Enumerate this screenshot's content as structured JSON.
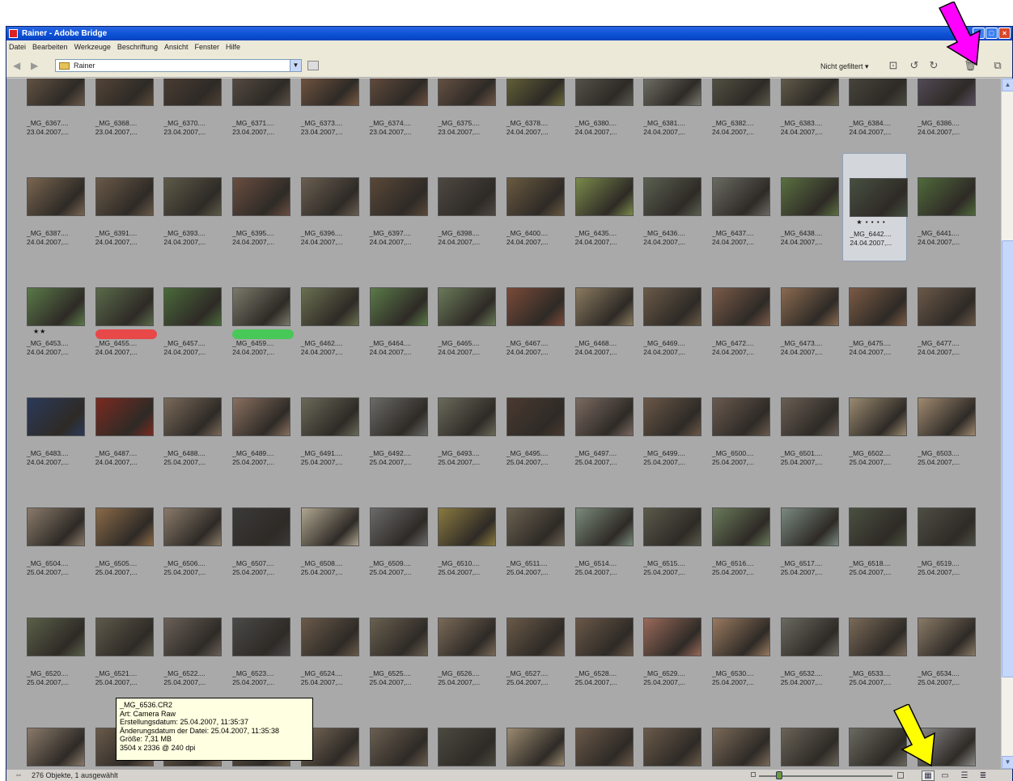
{
  "window": {
    "title": "Rainer - Adobe Bridge",
    "controls": [
      "_",
      "□",
      "×"
    ]
  },
  "menu": [
    "Datei",
    "Bearbeiten",
    "Werkzeuge",
    "Beschriftung",
    "Ansicht",
    "Fenster",
    "Hilfe"
  ],
  "toolbar": {
    "path": "Rainer",
    "filter_label": "Nicht gefiltert ▾"
  },
  "thumbnails": [
    {
      "name": "_MG_6367....",
      "date": "23.04.2007,...",
      "color": "#6b5a48"
    },
    {
      "name": "_MG_6368....",
      "date": "23.04.2007,...",
      "color": "#5a4a3a"
    },
    {
      "name": "_MG_6370....",
      "date": "23.04.2007,...",
      "color": "#4e4034"
    },
    {
      "name": "_MG_6371....",
      "date": "23.04.2007,...",
      "color": "#5b5046"
    },
    {
      "name": "_MG_6373....",
      "date": "23.04.2007,...",
      "color": "#7a5a44"
    },
    {
      "name": "_MG_6374....",
      "date": "23.04.2007,...",
      "color": "#6a5040"
    },
    {
      "name": "_MG_6375....",
      "date": "23.04.2007,...",
      "color": "#705848"
    },
    {
      "name": "_MG_6378....",
      "date": "24.04.2007,...",
      "color": "#6b6a3a"
    },
    {
      "name": "_MG_6380....",
      "date": "24.04.2007,...",
      "color": "#5a5a50"
    },
    {
      "name": "_MG_6381....",
      "date": "24.04.2007,...",
      "color": "#7a7a70"
    },
    {
      "name": "_MG_6382....",
      "date": "24.04.2007,...",
      "color": "#5a5848"
    },
    {
      "name": "_MG_6383....",
      "date": "24.04.2007,...",
      "color": "#6a6450"
    },
    {
      "name": "_MG_6384....",
      "date": "24.04.2007,...",
      "color": "#4a4a40"
    },
    {
      "name": "_MG_6386....",
      "date": "24.04.2007,...",
      "color": "#5a5060"
    },
    {
      "name": "_MG_6387....",
      "date": "24.04.2007,...",
      "color": "#7a6650"
    },
    {
      "name": "_MG_6391....",
      "date": "24.04.2007,...",
      "color": "#6a5a48"
    },
    {
      "name": "_MG_6393....",
      "date": "24.04.2007,...",
      "color": "#5e5a48"
    },
    {
      "name": "_MG_6395....",
      "date": "24.04.2007,...",
      "color": "#6a4e40"
    },
    {
      "name": "_MG_6396....",
      "date": "24.04.2007,...",
      "color": "#6a5e50"
    },
    {
      "name": "_MG_6397....",
      "date": "24.04.2007,...",
      "color": "#5a4838"
    },
    {
      "name": "_MG_6398....",
      "date": "24.04.2007,...",
      "color": "#4e4842"
    },
    {
      "name": "_MG_6400....",
      "date": "24.04.2007,...",
      "color": "#6a5a40"
    },
    {
      "name": "_MG_6435....",
      "date": "24.04.2007,...",
      "color": "#7a8a4a"
    },
    {
      "name": "_MG_6436....",
      "date": "24.04.2007,...",
      "color": "#5a6050"
    },
    {
      "name": "_MG_6437....",
      "date": "24.04.2007,...",
      "color": "#6a6a62"
    },
    {
      "name": "_MG_6438....",
      "date": "24.04.2007,...",
      "color": "#5a7040"
    },
    {
      "name": "_MG_6442....",
      "date": "24.04.2007,...",
      "color": "#465040",
      "selected": true,
      "stars": "★ • • • •"
    },
    {
      "name": "_MG_6441....",
      "date": "24.04.2007,...",
      "color": "#506a3a"
    },
    {
      "name": "_MG_6453....",
      "date": "24.04.2007,...",
      "color": "#5a7a48",
      "stars": "★★"
    },
    {
      "name": "_MG_6455....",
      "date": "24.04.2007,...",
      "color": "#5a6a4a",
      "label": "#e84848"
    },
    {
      "name": "_MG_6457....",
      "date": "24.04.2007,...",
      "color": "#4a6a3a"
    },
    {
      "name": "_MG_6459....",
      "date": "24.04.2007,...",
      "color": "#7a7a6a",
      "label": "#48c858"
    },
    {
      "name": "_MG_6462....",
      "date": "24.04.2007,...",
      "color": "#6a7050"
    },
    {
      "name": "_MG_6464....",
      "date": "24.04.2007,...",
      "color": "#5a7a48"
    },
    {
      "name": "_MG_6465....",
      "date": "24.04.2007,...",
      "color": "#6a7a58"
    },
    {
      "name": "_MG_6467....",
      "date": "24.04.2007,...",
      "color": "#7a4a38"
    },
    {
      "name": "_MG_6468....",
      "date": "24.04.2007,...",
      "color": "#8a7a60"
    },
    {
      "name": "_MG_6469....",
      "date": "24.04.2007,...",
      "color": "#6a5a48"
    },
    {
      "name": "_MG_6472....",
      "date": "24.04.2007,...",
      "color": "#7a5a48"
    },
    {
      "name": "_MG_6473....",
      "date": "24.04.2007,...",
      "color": "#8a6a50"
    },
    {
      "name": "_MG_6475....",
      "date": "24.04.2007,...",
      "color": "#7a5a44"
    },
    {
      "name": "_MG_6477....",
      "date": "24.04.2007,...",
      "color": "#6a5848"
    },
    {
      "name": "_MG_6483....",
      "date": "24.04.2007,...",
      "color": "#2a3a5a"
    },
    {
      "name": "_MG_6487....",
      "date": "24.04.2007,...",
      "color": "#7a2a20"
    },
    {
      "name": "_MG_6488....",
      "date": "25.04.2007,...",
      "color": "#7a6a5a"
    },
    {
      "name": "_MG_6489....",
      "date": "25.04.2007,...",
      "color": "#8a7060"
    },
    {
      "name": "_MG_6491....",
      "date": "25.04.2007,...",
      "color": "#6a6a58"
    },
    {
      "name": "_MG_6492....",
      "date": "25.04.2007,...",
      "color": "#6a6a66"
    },
    {
      "name": "_MG_6493....",
      "date": "25.04.2007,...",
      "color": "#6a6a5a"
    },
    {
      "name": "_MG_6495....",
      "date": "25.04.2007,...",
      "color": "#4a3a30"
    },
    {
      "name": "_MG_6497....",
      "date": "25.04.2007,...",
      "color": "#7a6a60"
    },
    {
      "name": "_MG_6499....",
      "date": "25.04.2007,...",
      "color": "#6a5848"
    },
    {
      "name": "_MG_6500....",
      "date": "25.04.2007,...",
      "color": "#6a5a4e"
    },
    {
      "name": "_MG_6501....",
      "date": "25.04.2007,...",
      "color": "#6a5e54"
    },
    {
      "name": "_MG_6502....",
      "date": "25.04.2007,...",
      "color": "#9a8a70"
    },
    {
      "name": "_MG_6503....",
      "date": "25.04.2007,...",
      "color": "#a08a70"
    },
    {
      "name": "_MG_6504....",
      "date": "25.04.2007,...",
      "color": "#8a7a6a"
    },
    {
      "name": "_MG_6505....",
      "date": "25.04.2007,...",
      "color": "#8a6a48"
    },
    {
      "name": "_MG_6506....",
      "date": "25.04.2007,...",
      "color": "#8a7a6a"
    },
    {
      "name": "_MG_6507....",
      "date": "25.04.2007,...",
      "color": "#3a3a38"
    },
    {
      "name": "_MG_6508....",
      "date": "25.04.2007,...",
      "color": "#b0a690"
    },
    {
      "name": "_MG_6509....",
      "date": "25.04.2007,...",
      "color": "#6a6a6a"
    },
    {
      "name": "_MG_6510....",
      "date": "25.04.2007,...",
      "color": "#8a7a40"
    },
    {
      "name": "_MG_6511....",
      "date": "25.04.2007,...",
      "color": "#6a6050"
    },
    {
      "name": "_MG_6514....",
      "date": "25.04.2007,...",
      "color": "#7a8a7a"
    },
    {
      "name": "_MG_6515....",
      "date": "25.04.2007,...",
      "color": "#5a5a4a"
    },
    {
      "name": "_MG_6516....",
      "date": "25.04.2007,...",
      "color": "#6a7a5a"
    },
    {
      "name": "_MG_6517....",
      "date": "25.04.2007,...",
      "color": "#7a8a80"
    },
    {
      "name": "_MG_6518....",
      "date": "25.04.2007,...",
      "color": "#4a5040"
    },
    {
      "name": "_MG_6519....",
      "date": "25.04.2007,...",
      "color": "#4e4e44"
    },
    {
      "name": "_MG_6520....",
      "date": "25.04.2007,...",
      "color": "#5a6048"
    },
    {
      "name": "_MG_6521....",
      "date": "25.04.2007,...",
      "color": "#5e5a4a"
    },
    {
      "name": "_MG_6522....",
      "date": "25.04.2007,...",
      "color": "#6a6058"
    },
    {
      "name": "_MG_6523....",
      "date": "25.04.2007,...",
      "color": "#4a4a48"
    },
    {
      "name": "_MG_6524....",
      "date": "25.04.2007,...",
      "color": "#6a5a4a"
    },
    {
      "name": "_MG_6525....",
      "date": "25.04.2007,...",
      "color": "#6a6050"
    },
    {
      "name": "_MG_6526....",
      "date": "25.04.2007,...",
      "color": "#7a6a58"
    },
    {
      "name": "_MG_6527....",
      "date": "25.04.2007,...",
      "color": "#6a5a48"
    },
    {
      "name": "_MG_6528....",
      "date": "25.04.2007,...",
      "color": "#6a5848"
    },
    {
      "name": "_MG_6529....",
      "date": "25.04.2007,...",
      "color": "#9a6a5a"
    },
    {
      "name": "_MG_6530....",
      "date": "25.04.2007,...",
      "color": "#9a7a60"
    },
    {
      "name": "_MG_6532....",
      "date": "25.04.2007,...",
      "color": "#6a6a60"
    },
    {
      "name": "_MG_6533....",
      "date": "25.04.2007,...",
      "color": "#7a6a58"
    },
    {
      "name": "_MG_6534....",
      "date": "25.04.2007,...",
      "color": "#8a7a66"
    },
    {
      "color": "#8a7a6a"
    },
    {
      "color": "#6a5a4a"
    },
    {
      "color": "#7a6a58"
    },
    {
      "color": "#6a5a48"
    },
    {
      "color": "#7a6a58"
    },
    {
      "color": "#6a5e50"
    },
    {
      "color": "#4a4a40"
    },
    {
      "color": "#9a8a70"
    },
    {
      "color": "#6a5848"
    },
    {
      "color": "#6a5a4a"
    },
    {
      "color": "#7a6a58"
    },
    {
      "color": "#6a6458"
    },
    {
      "color": "#6a6a60"
    },
    {
      "color": "#8a8a88"
    }
  ],
  "tooltip": {
    "lines": [
      "_MG_6536.CR2",
      "Art: Camera Raw",
      "Erstellungsdatum: 25.04.2007, 11:35:37",
      "Änderungsdatum der Datei: 25.04.2007, 11:35:38",
      "Größe: 7,31 MB",
      "3504 x 2336 @ 240 dpi"
    ]
  },
  "status": {
    "text": "276 Objekte, 1 ausgewählt",
    "zoom_level": 0.15
  },
  "annotations": {
    "top_arrow_color": "#ff00ff",
    "bottom_arrow_color": "#ffff00"
  }
}
